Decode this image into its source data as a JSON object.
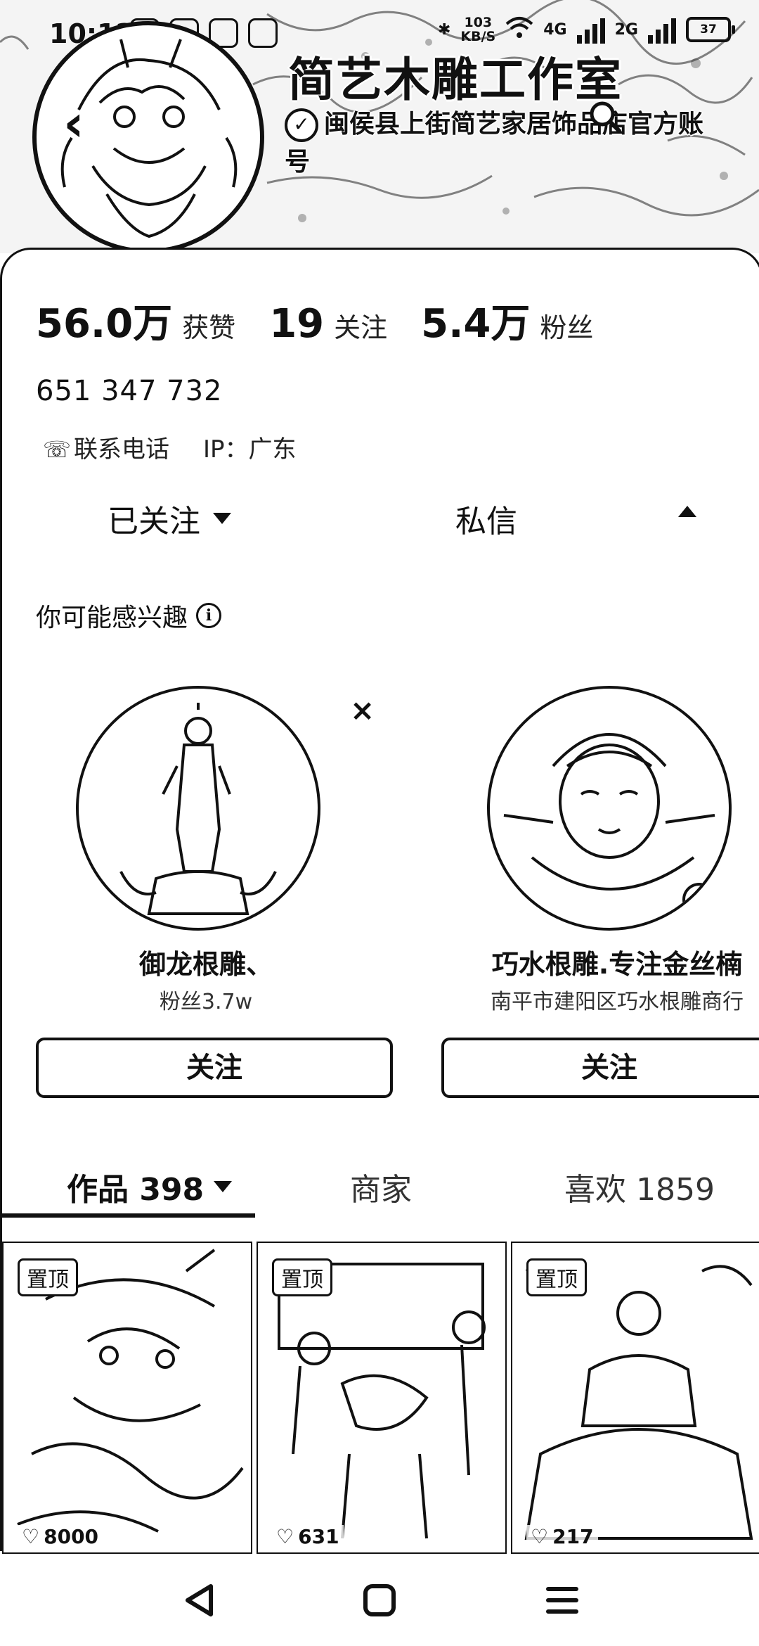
{
  "status_bar": {
    "time": "10:12",
    "net_speed_value": "103",
    "net_speed_unit": "KB/S",
    "net_type_1": "4G",
    "net_type_2": "2G",
    "battery": "37"
  },
  "profile": {
    "name": "简艺木雕工作室",
    "verification": "闽侯县上街简艺家居饰品店官方账号",
    "stats": [
      {
        "value": "56.0万",
        "label": "获赞"
      },
      {
        "value": "19",
        "label": "关注"
      },
      {
        "value": "5.4万",
        "label": "粉丝"
      }
    ],
    "user_id": "651 347 732",
    "contact_label": "联系电话",
    "ip_label": "IP：广东"
  },
  "actions": {
    "follow_state": "已关注",
    "message": "私信"
  },
  "suggestions": {
    "title": "你可能感兴趣",
    "items": [
      {
        "name": "御龙根雕、",
        "sub": "粉丝3.7w",
        "button": "关注"
      },
      {
        "name": "巧水根雕.专注金丝楠",
        "sub": "南平市建阳区巧水根雕商行",
        "button": "关注"
      }
    ]
  },
  "tabs": {
    "works": "作品 398",
    "shop": "商家",
    "likes": "喜欢 1859"
  },
  "videos": [
    {
      "badge": "置顶",
      "likes": "8000"
    },
    {
      "badge": "置顶",
      "likes": "631"
    },
    {
      "badge": "置顶",
      "likes": "217"
    }
  ],
  "icons": {
    "back": "back-arrow-icon",
    "search": "search-icon",
    "verify": "verified-check-icon",
    "phone": "phone-link-icon",
    "info": "info-icon",
    "dismiss": "close-icon"
  }
}
